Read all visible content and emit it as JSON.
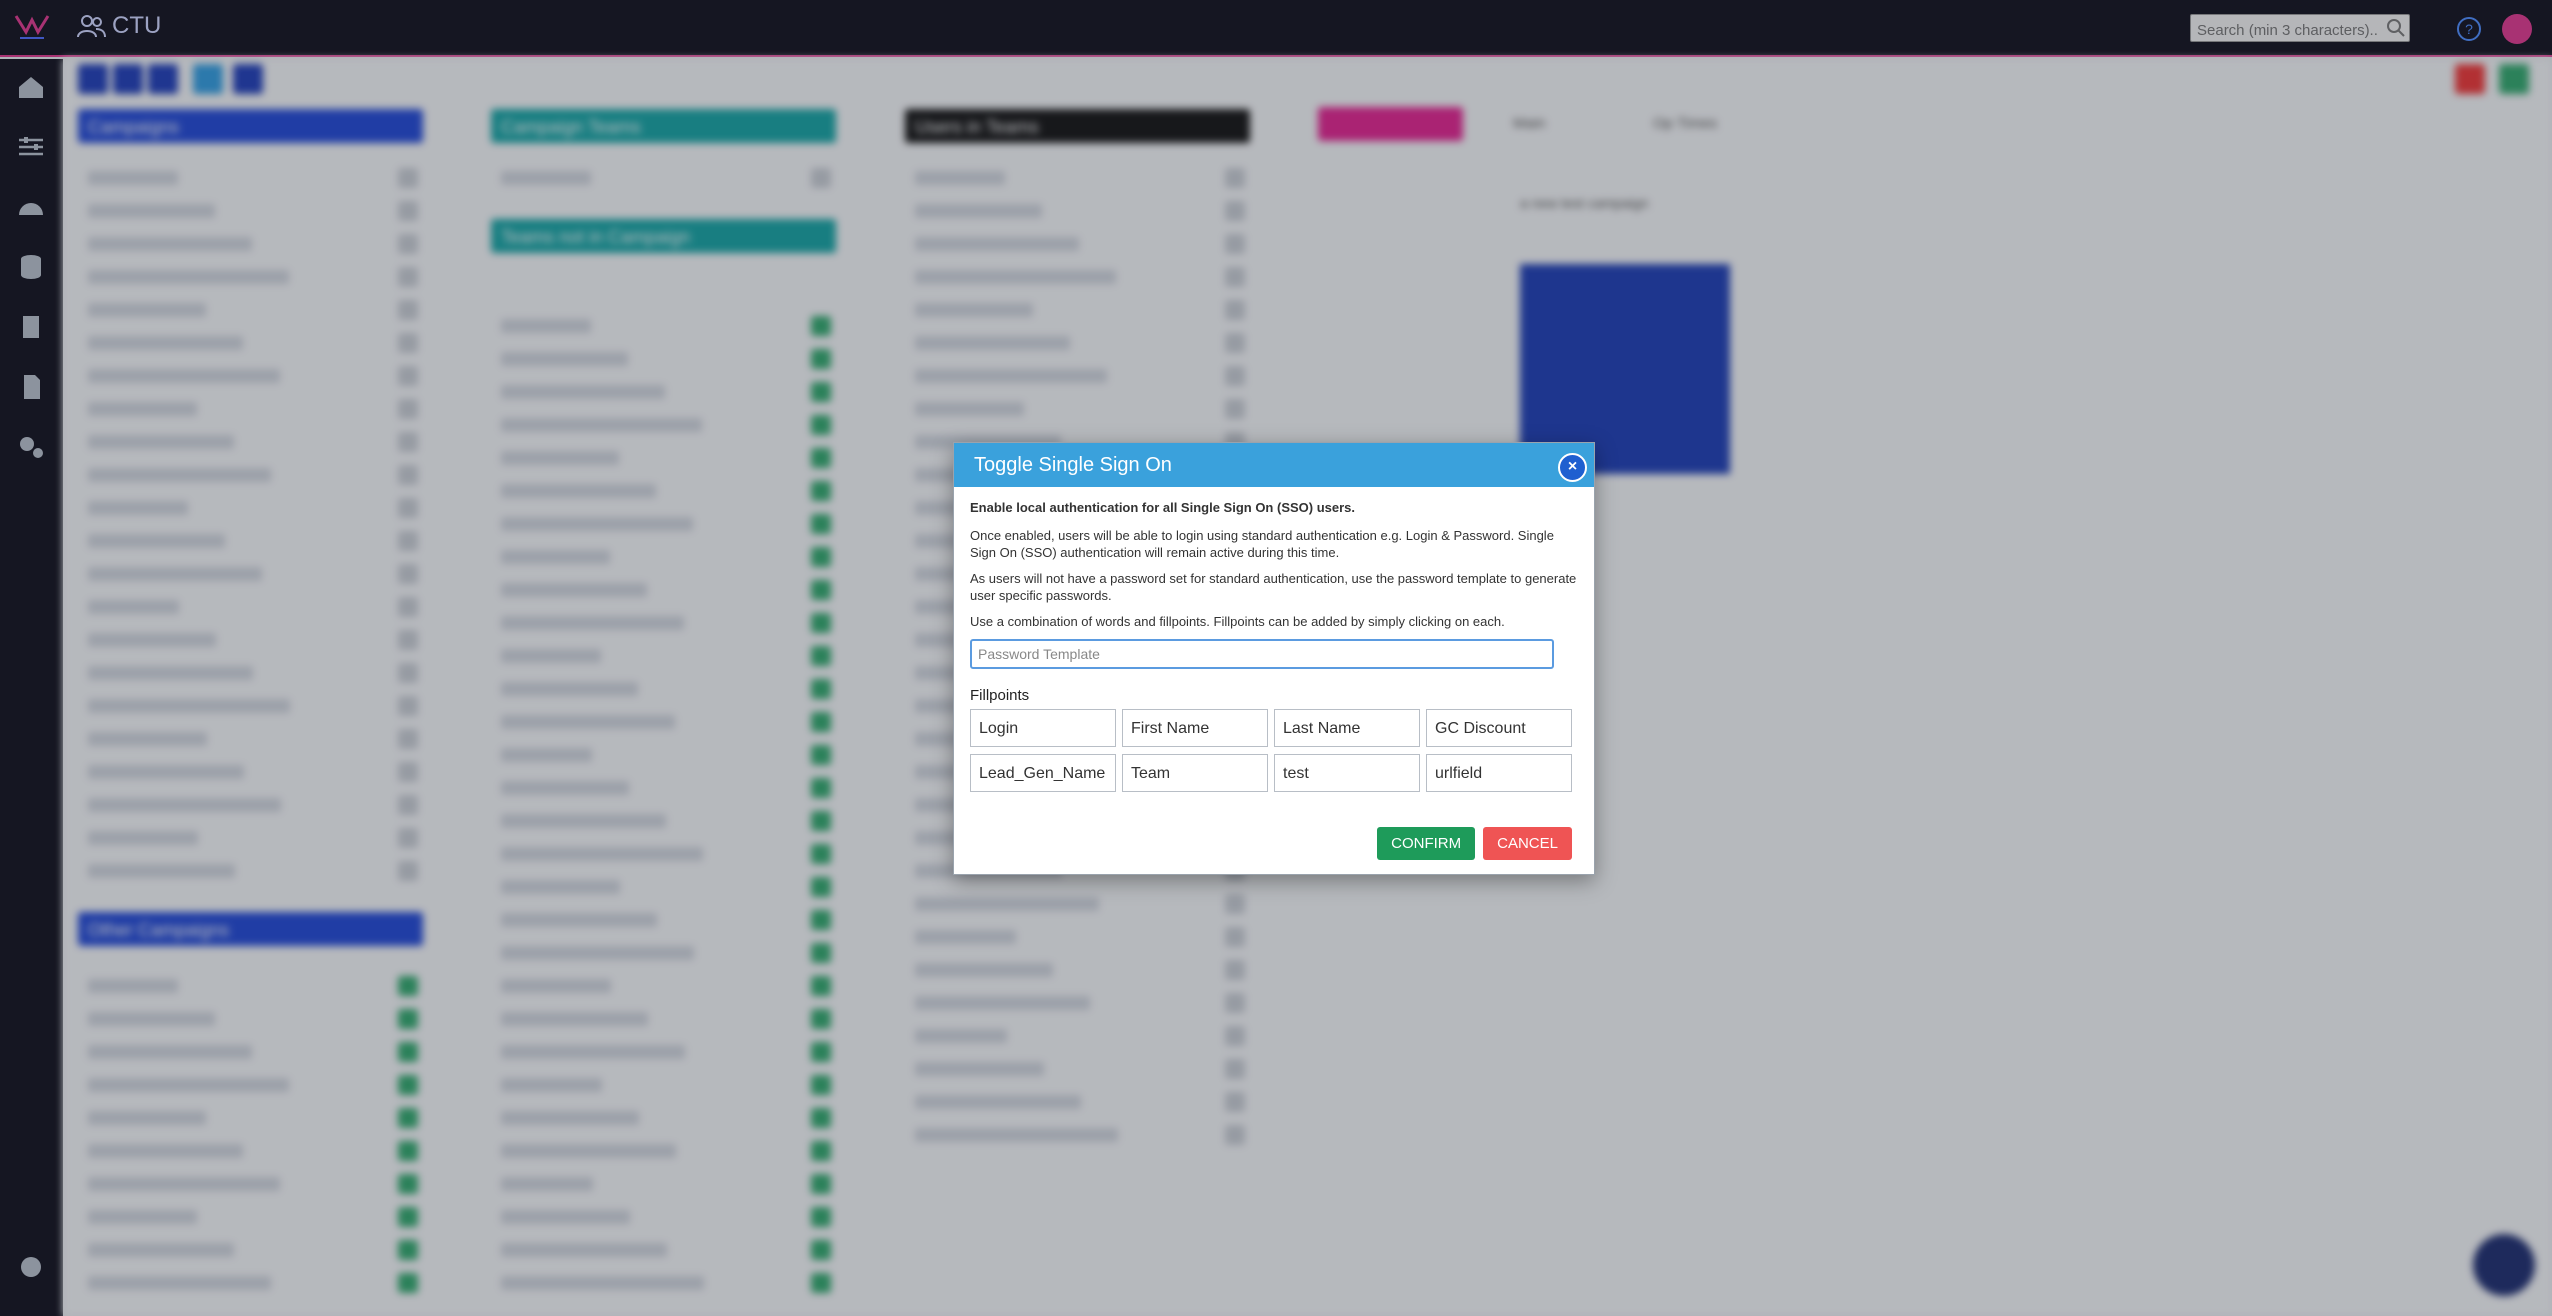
{
  "header": {
    "app_title": "CTU",
    "search_placeholder": "Search (min 3 characters)..."
  },
  "background": {
    "panels": [
      {
        "title": "Campaigns",
        "color": "#1e46d6"
      },
      {
        "title": "Campaign Teams",
        "color": "#12a3a3"
      },
      {
        "title": "Teams not in Campaign",
        "color": "#12a3a3"
      },
      {
        "title": "Users in Teams",
        "color": "#111111"
      },
      {
        "title": "Other Campaigns",
        "color": "#1e46d6"
      }
    ],
    "tabs": [
      "Main",
      "Op Times"
    ],
    "campaign_name": "a new test campaign"
  },
  "modal": {
    "title": "Toggle Single Sign On",
    "close_label": "×",
    "lead": "Enable local authentication for all Single Sign On (SSO) users.",
    "para1": "Once enabled, users will be able to login using standard authentication e.g. Login & Password. Single Sign On (SSO) authentication will remain active during this time.",
    "para2": "As users will not have a password set for standard authentication, use the password template to generate user specific passwords.",
    "para3": "Use a combination of words and fillpoints. Fillpoints can be added by simply clicking on each.",
    "password_value": "",
    "password_placeholder": "Password Template",
    "fillpoints_title": "Fillpoints",
    "fillpoints": [
      "Login",
      "First Name",
      "Last Name",
      "GC Discount",
      "Lead_Gen_Name",
      "Team",
      "test",
      "urlfield"
    ],
    "confirm_label": "CONFIRM",
    "cancel_label": "CANCEL"
  },
  "colors": {
    "accent": "#e0368f",
    "modal_header": "#3aa1dc",
    "confirm": "#1e9b5a",
    "cancel": "#ef5454"
  }
}
